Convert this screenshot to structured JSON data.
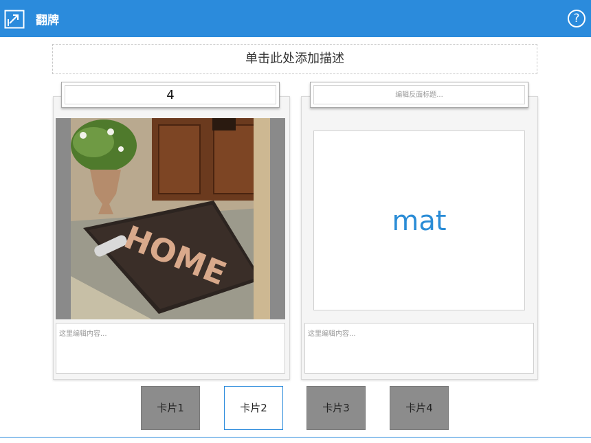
{
  "header": {
    "title": "翻牌",
    "help_label": "?"
  },
  "description": {
    "placeholder": "单击此处添加描述"
  },
  "front": {
    "title": "4",
    "content_placeholder": "这里编辑内容...",
    "image": {
      "caption_text": "HOME"
    }
  },
  "back": {
    "title_placeholder": "编辑反面标题...",
    "word": "mat",
    "content_placeholder": "这里编辑内容..."
  },
  "tabs": [
    {
      "label": "卡片1",
      "active": false
    },
    {
      "label": "卡片2",
      "active": true
    },
    {
      "label": "卡片3",
      "active": false
    },
    {
      "label": "卡片4",
      "active": false
    }
  ],
  "colors": {
    "accent": "#2b8bdc",
    "word": "#2a8cd6",
    "tab_inactive": "#8c8c8c"
  }
}
